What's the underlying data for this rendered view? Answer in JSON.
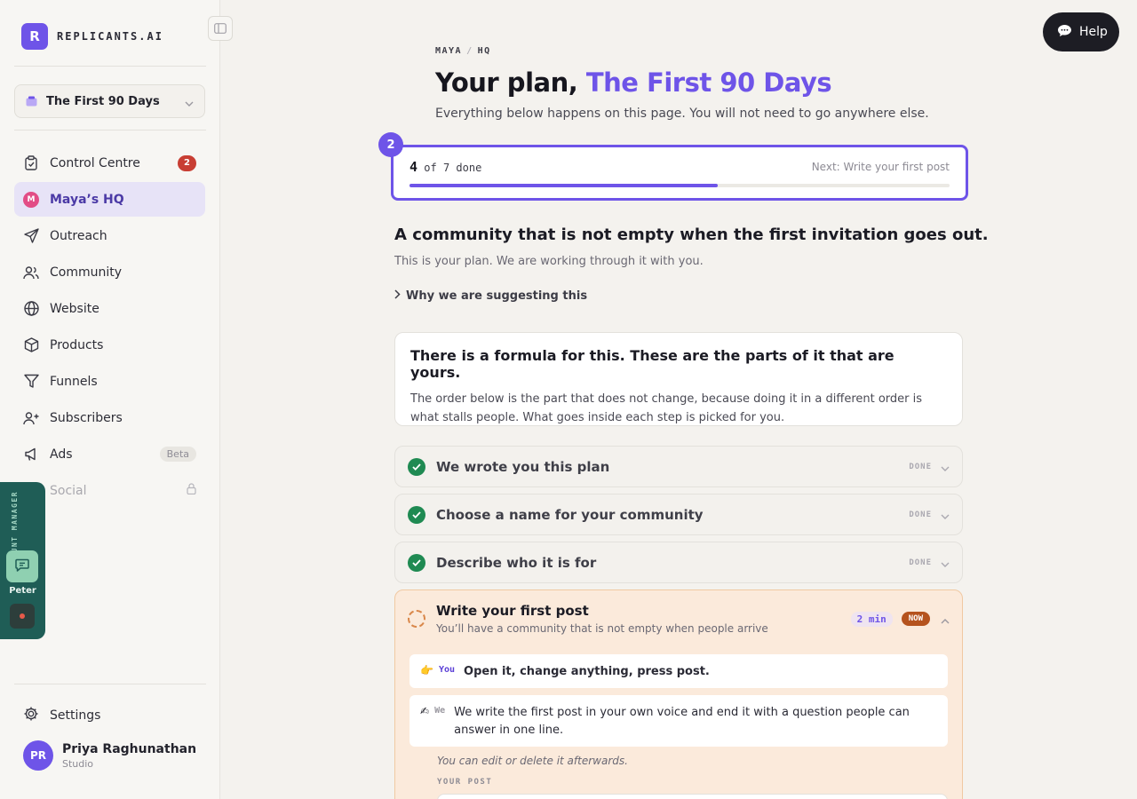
{
  "brand": {
    "logo_letter": "R",
    "name": "REPLICANTS.AI"
  },
  "plan_selector": {
    "label": "The First 90 Days"
  },
  "nav": {
    "items": [
      {
        "label": "Control Centre",
        "icon": "clipboard-icon",
        "badge": "2"
      },
      {
        "label": "Maya’s HQ",
        "icon": "maya-avatar-icon",
        "avatar_letter": "M",
        "active": true
      },
      {
        "label": "Outreach",
        "icon": "send-icon"
      },
      {
        "label": "Community",
        "icon": "users-icon"
      },
      {
        "label": "Website",
        "icon": "globe-icon"
      },
      {
        "label": "Products",
        "icon": "box-icon"
      },
      {
        "label": "Funnels",
        "icon": "funnel-icon"
      },
      {
        "label": "Subscribers",
        "icon": "subscribers-icon"
      },
      {
        "label": "Ads",
        "icon": "megaphone-icon",
        "pill": "Beta"
      },
      {
        "label": "Social",
        "icon": "social-icon",
        "locked": true
      }
    ],
    "settings": "Settings"
  },
  "user": {
    "initials": "PR",
    "name": "Priya Raghunathan",
    "role": "Studio"
  },
  "account_manager": {
    "label": "ACCOUNT MANAGER",
    "name": "Peter"
  },
  "help": {
    "label": "Help"
  },
  "header": {
    "crumb_1": "MAYA",
    "crumb_sep": "/",
    "crumb_2": "HQ",
    "title_prefix": "Your plan,",
    "title_accent": "The First 90 Days",
    "subtitle": "Everything below happens on this page. You will not need to go anywhere else."
  },
  "progress": {
    "step_number": "2",
    "done": "4",
    "of_text": "of 7 done",
    "next": "Next: Write your first post",
    "fraction": 0.57
  },
  "goal": {
    "heading": "A community that is not empty when the first invitation goes out.",
    "sub": "This is your plan. We are working through it with you.",
    "why": "Why we are suggesting this"
  },
  "formula": {
    "title": "There is a formula for this. These are the parts of it that are yours.",
    "body": "The order below is the part that does not change, because doing it in a different order is what stalls people. What goes inside each step is picked for you."
  },
  "steps": [
    {
      "label": "We wrote you this plan",
      "status": "DONE"
    },
    {
      "label": "Choose a name for your community",
      "status": "DONE"
    },
    {
      "label": "Describe who it is for",
      "status": "DONE"
    }
  ],
  "active_step": {
    "title": "Write your first post",
    "sub": "You’ll have a community that is not empty when people arrive",
    "time": "2 min",
    "tag": "NOW",
    "you_emoji": "👉",
    "you_label": "You",
    "you_text": "Open it, change anything, press post.",
    "we_emoji": "✍",
    "we_label": "We",
    "we_text": "We write the first post in your own voice and end it with a question people can answer in one line.",
    "edit_note": "You can edit or delete it afterwards.",
    "post_label": "YOUR POST"
  },
  "colors": {
    "accent": "#6e54e8",
    "done": "#1f8a52",
    "now": "#b5531e",
    "badge": "#c83e33",
    "am_bg": "#1f5d56"
  }
}
